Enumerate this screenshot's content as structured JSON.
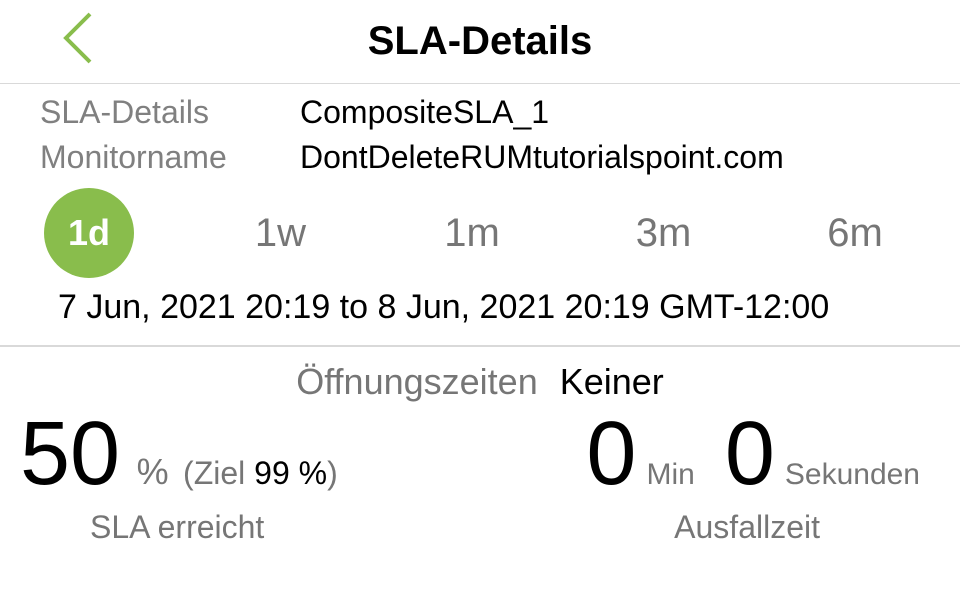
{
  "header": {
    "title": "SLA-Details"
  },
  "details": {
    "sla_label": "SLA-Details",
    "sla_value": "CompositeSLA_1",
    "monitor_label": "Monitorname",
    "monitor_value": "DontDeleteRUMtutorialspoint.com"
  },
  "tabs": {
    "d1": "1d",
    "w1": "1w",
    "m1": "1m",
    "m3": "3m",
    "m6": "6m"
  },
  "timerange": "7 Jun, 2021 20:19 to 8 Jun, 2021 20:19 GMT-12:00",
  "hours": {
    "label": "Öffnungszeiten",
    "value": "Keiner"
  },
  "sla": {
    "value": "50",
    "unit": "%",
    "goal_prefix": "(Ziel ",
    "goal_value": "99 %",
    "goal_suffix": ")",
    "label": "SLA erreicht"
  },
  "downtime": {
    "min_value": "0",
    "min_unit": "Min",
    "sec_value": "0",
    "sec_unit": "Sekunden",
    "label": "Ausfallzeit"
  }
}
